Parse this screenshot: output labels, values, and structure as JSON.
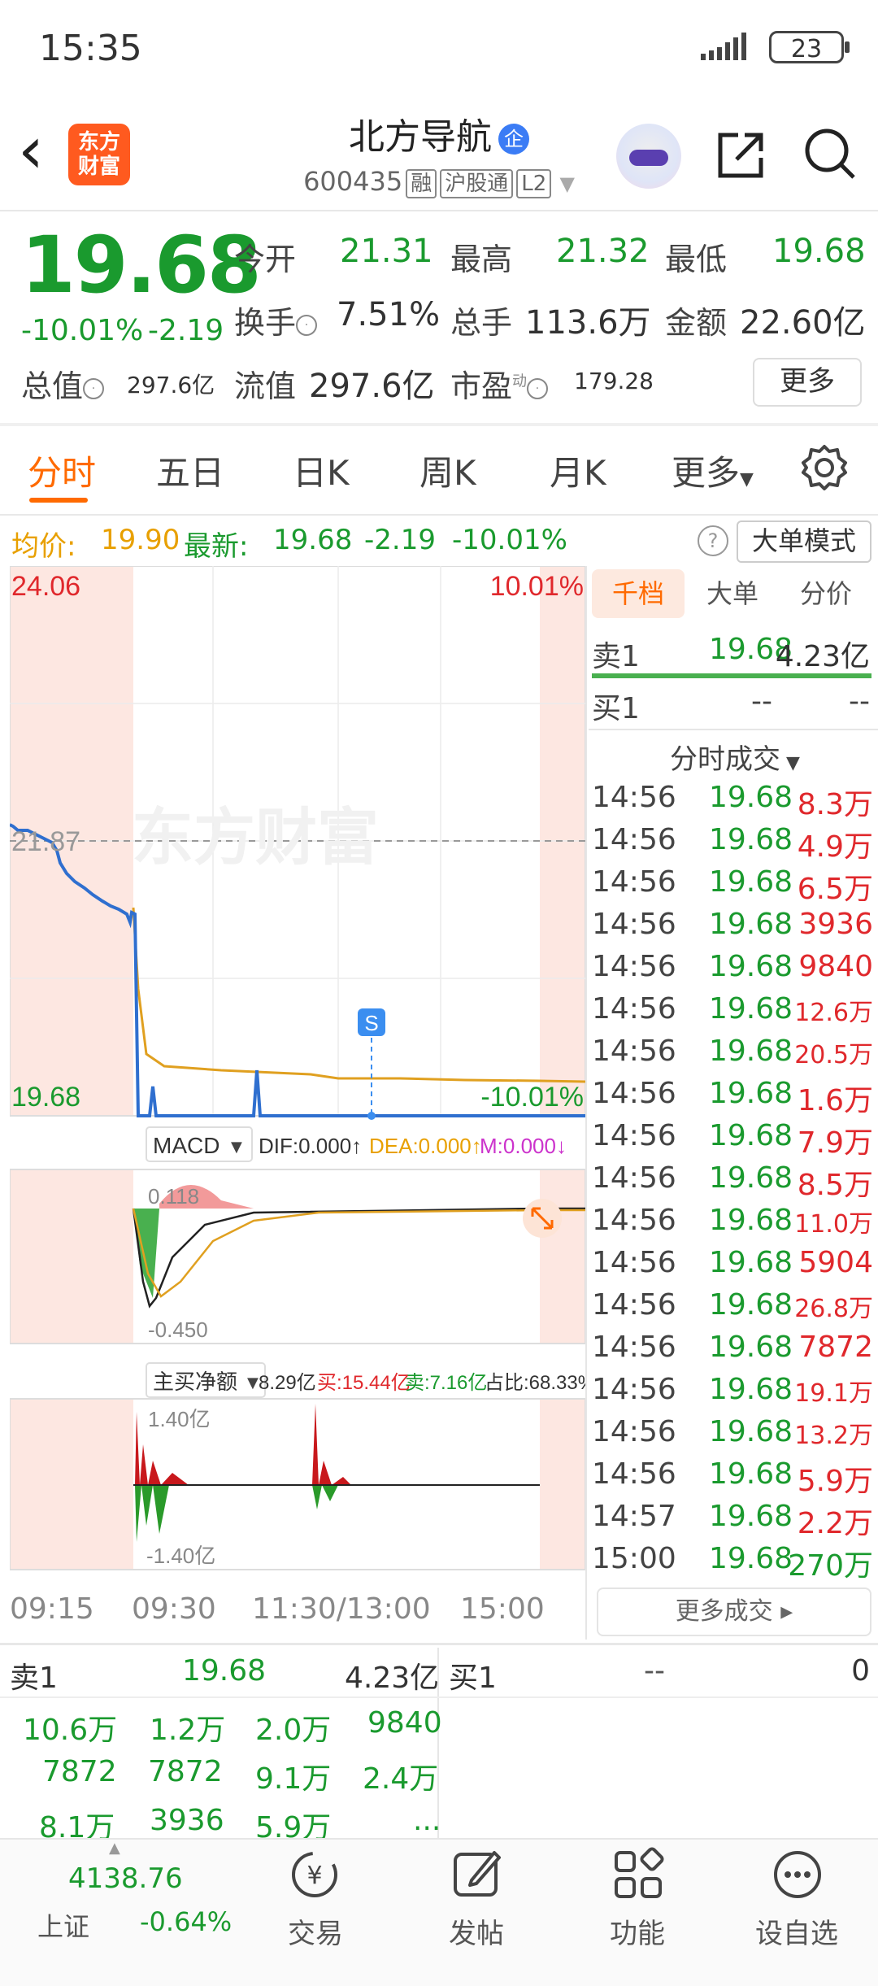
{
  "status_bar": {
    "time": "15:35",
    "battery": "23"
  },
  "header": {
    "logo_text_1": "东方",
    "logo_text_2": "财富",
    "stock_name": "北方导航",
    "cert_badge": "企",
    "code": "600435",
    "tags": [
      "融",
      "沪股通",
      "L2"
    ]
  },
  "quote": {
    "price": "19.68",
    "change_pct": "-10.01%",
    "change_abs": "-2.19",
    "open_label": "今开",
    "open": "21.31",
    "high_label": "最高",
    "high": "21.32",
    "low_label": "最低",
    "low": "19.68",
    "turnover_label": "换手",
    "turnover": "7.51%",
    "volume_label": "总手",
    "volume": "113.6万",
    "amount_label": "金额",
    "amount": "22.60亿",
    "mktcap_label": "总值",
    "mktcap": "297.6亿",
    "float_label": "流值",
    "float_cap": "297.6亿",
    "pe_label": "市盈",
    "pe_sup": "动",
    "pe": "179.28",
    "more_button": "更多"
  },
  "tabs": [
    "分时",
    "五日",
    "日K",
    "周K",
    "月K",
    "更多"
  ],
  "avg_bar": {
    "avg_label": "均价:",
    "avg": "19.90",
    "latest_label": "最新:",
    "latest": "19.68",
    "chg": "-2.19",
    "pct": "-10.01%",
    "help": "?",
    "big_order_button": "大单模式"
  },
  "chart_labels": {
    "top_price": "24.06",
    "top_pct": "10.01%",
    "mid_price": "21.87",
    "bottom_price": "19.68",
    "bottom_pct": "-10.01%",
    "watermark": "东方财富",
    "s_marker": "S",
    "macd_button": "MACD",
    "dif": "DIF:0.000↑",
    "dea": "DEA:0.000↑",
    "m": "M:0.000↓",
    "macd_top": "0.118",
    "macd_bottom": "-0.450",
    "flow_button": "主买净额",
    "flow_total": "8.29亿",
    "flow_buy": "买:15.44亿",
    "flow_sell": "卖:7.16亿",
    "flow_ratio": "占比:68.33%",
    "flow_top": "1.40亿",
    "flow_bottom": "-1.40亿",
    "x_ticks": [
      "09:15",
      "09:30",
      "11:30/13:00",
      "15:00"
    ]
  },
  "right_panel": {
    "tabs": [
      "千档",
      "大单",
      "分价"
    ],
    "sell1_label": "卖1",
    "sell1_price": "19.68",
    "sell1_vol": "4.23亿",
    "buy1_label": "买1",
    "buy1_price": "--",
    "buy1_vol": "--",
    "trades_title": "分时成交",
    "trades": [
      {
        "t": "14:56",
        "p": "19.68",
        "v": "8.3万"
      },
      {
        "t": "14:56",
        "p": "19.68",
        "v": "4.9万"
      },
      {
        "t": "14:56",
        "p": "19.68",
        "v": "6.5万"
      },
      {
        "t": "14:56",
        "p": "19.68",
        "v": "3936"
      },
      {
        "t": "14:56",
        "p": "19.68",
        "v": "9840"
      },
      {
        "t": "14:56",
        "p": "19.68",
        "v": "12.6万"
      },
      {
        "t": "14:56",
        "p": "19.68",
        "v": "20.5万"
      },
      {
        "t": "14:56",
        "p": "19.68",
        "v": "1.6万"
      },
      {
        "t": "14:56",
        "p": "19.68",
        "v": "7.9万"
      },
      {
        "t": "14:56",
        "p": "19.68",
        "v": "8.5万"
      },
      {
        "t": "14:56",
        "p": "19.68",
        "v": "11.0万"
      },
      {
        "t": "14:56",
        "p": "19.68",
        "v": "5904"
      },
      {
        "t": "14:56",
        "p": "19.68",
        "v": "26.8万"
      },
      {
        "t": "14:56",
        "p": "19.68",
        "v": "7872"
      },
      {
        "t": "14:56",
        "p": "19.68",
        "v": "19.1万"
      },
      {
        "t": "14:56",
        "p": "19.68",
        "v": "13.2万"
      },
      {
        "t": "14:56",
        "p": "19.68",
        "v": "5.9万"
      },
      {
        "t": "14:57",
        "p": "19.68",
        "v": "2.2万"
      },
      {
        "t": "15:00",
        "p": "19.68",
        "v": "270万"
      }
    ],
    "more_trades": "更多成交"
  },
  "order_book": {
    "sell_label": "卖1",
    "sell_price": "19.68",
    "sell_vol": "4.23亿",
    "buy_label": "买1",
    "buy_price": "--",
    "buy_vol": "0",
    "queue": [
      [
        "10.6万",
        "1.2万",
        "2.0万",
        "9840"
      ],
      [
        "7872",
        "7872",
        "9.1万",
        "2.4万"
      ],
      [
        "8.1万",
        "3936",
        "5.9万",
        "..."
      ]
    ]
  },
  "bottom_nav": {
    "index_value": "4138.76",
    "index_name": "上证",
    "index_chg": "-0.64%",
    "trade": "交易",
    "post": "发帖",
    "func": "功能",
    "watch": "设自选"
  },
  "colors": {
    "up": "#e0282c",
    "down": "#1a9a2e",
    "accent": "#ff6a00",
    "price_line": "#2f6fcf",
    "avg_line": "#e0a020"
  }
}
